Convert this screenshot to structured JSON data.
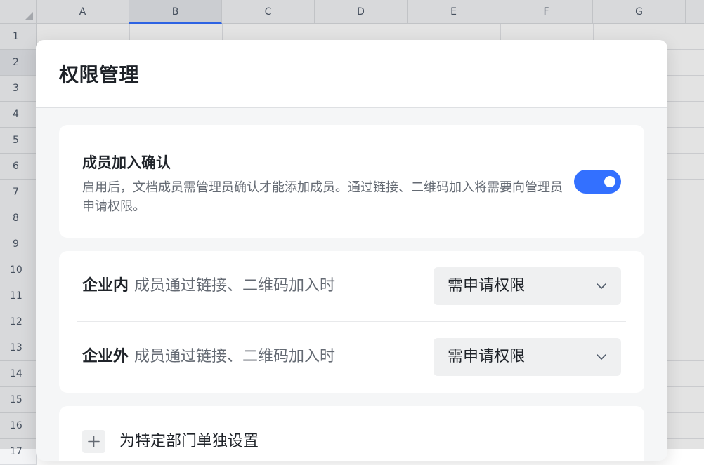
{
  "sheet": {
    "columns": [
      "A",
      "B",
      "C",
      "D",
      "E",
      "F",
      "G"
    ],
    "selected_column": "B",
    "rows": [
      "1",
      "2",
      "3",
      "4",
      "5",
      "6",
      "7",
      "8",
      "9",
      "10",
      "11",
      "12",
      "13",
      "14",
      "15",
      "16",
      "17"
    ],
    "selected_row": "2"
  },
  "dialog": {
    "title": "权限管理",
    "member_confirm": {
      "title": "成员加入确认",
      "description": "启用后，文档成员需管理员确认才能添加成员。通过链接、二维码加入将需要向管理员申请权限。",
      "enabled": true
    },
    "scopes": [
      {
        "label_strong": "企业内",
        "label_text": "成员通过链接、二维码加入时",
        "selected_option": "需申请权限"
      },
      {
        "label_strong": "企业外",
        "label_text": "成员通过链接、二维码加入时",
        "selected_option": "需申请权限"
      }
    ],
    "department": {
      "label": "为特定部门单独设置"
    }
  },
  "colors": {
    "accent": "#3370ff",
    "text_primary": "#1f2329",
    "text_secondary": "#646a73"
  },
  "icons": [
    "chevron-down-icon",
    "plus-icon"
  ]
}
